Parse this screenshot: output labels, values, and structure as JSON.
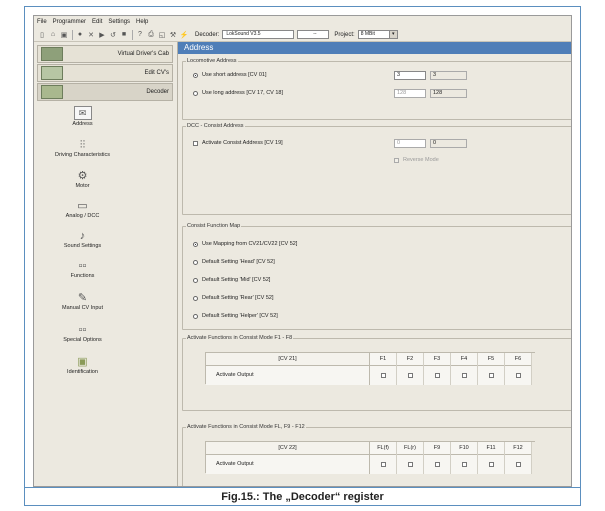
{
  "menu": [
    "File",
    "Programmer",
    "Edit",
    "Settings",
    "Help"
  ],
  "toolbar": {
    "icons": [
      "new-icon",
      "open-icon",
      "save-icon",
      "record-icon",
      "delete-icon",
      "play-icon",
      "undo-icon",
      "stop-icon",
      "help-icon",
      "print-icon",
      "preview-icon",
      "tools-icon",
      "connect-icon"
    ],
    "decoder_label": "Decoder:",
    "decoder_value": "LokSound V3.5",
    "decoder_extra": "--",
    "project_label": "Project:",
    "project_value": "8 MBit"
  },
  "window_title": "Address",
  "sidebar": {
    "main_buttons": [
      {
        "label": "Virtual Driver's Cab",
        "icon": "cab-icon"
      },
      {
        "label": "Edit CV's",
        "icon": "grid-icon"
      },
      {
        "label": "Decoder",
        "icon": "decoder-icon"
      }
    ],
    "items": [
      {
        "label": "Address",
        "icon": "envelope-icon",
        "glyph": "✉"
      },
      {
        "label": "Driving Characteristics",
        "icon": "sliders-icon",
        "glyph": "⫶⫶"
      },
      {
        "label": "Motor",
        "icon": "motor-icon",
        "glyph": "⚙"
      },
      {
        "label": "Analog / DCC",
        "icon": "dcc-icon",
        "glyph": "▭"
      },
      {
        "label": "Sound Settings",
        "icon": "music-icon",
        "glyph": "♪"
      },
      {
        "label": "Functions",
        "icon": "functions-icon",
        "glyph": "▫▫"
      },
      {
        "label": "Manual CV Input",
        "icon": "pencil-icon",
        "glyph": "✎"
      },
      {
        "label": "Special Options",
        "icon": "options-icon",
        "glyph": "▫▫"
      },
      {
        "label": "Identification",
        "icon": "chip-icon",
        "glyph": "▣"
      }
    ]
  },
  "loco_address": {
    "title": "Locomotive Address",
    "short_label": "Use short address [CV 01]",
    "short_value": "3",
    "short_readout": "3",
    "long_label": "Use long address [CV 17, CV 18]",
    "long_value": "128",
    "long_readout": "128"
  },
  "consist_address": {
    "title": "DCC - Consist Address",
    "activate_label": "Activate Consist Address [CV 19]",
    "value": "0",
    "readout": "0",
    "reverse_label": "Reverse Mode"
  },
  "function_map": {
    "title": "Consist Function Map",
    "options": [
      "Use Mapping from CV21/CV22 [CV 52]",
      "Default Setting 'Head' [CV 52]",
      "Default Setting 'Mid' [CV 52]",
      "Default Setting 'Rear' [CV 52]",
      "Default Setting 'Helper' [CV 52]"
    ]
  },
  "consist_f1_f8": {
    "title": "Activate Functions in Consist Mode F1 - F8",
    "cv": "[CV 21]",
    "row_label": "Activate Output",
    "columns": [
      "F1",
      "F2",
      "F3",
      "F4",
      "F5",
      "F6"
    ]
  },
  "consist_fl_f12": {
    "title": "Activate Functions in Consist Mode FL, F9 - F12",
    "cv": "[CV 22]",
    "row_label": "Activate Output",
    "columns": [
      "FL(f)",
      "FL(r)",
      "F9",
      "F10",
      "F11",
      "F12"
    ]
  },
  "caption": "Fig.15.: The „Decoder“ register"
}
